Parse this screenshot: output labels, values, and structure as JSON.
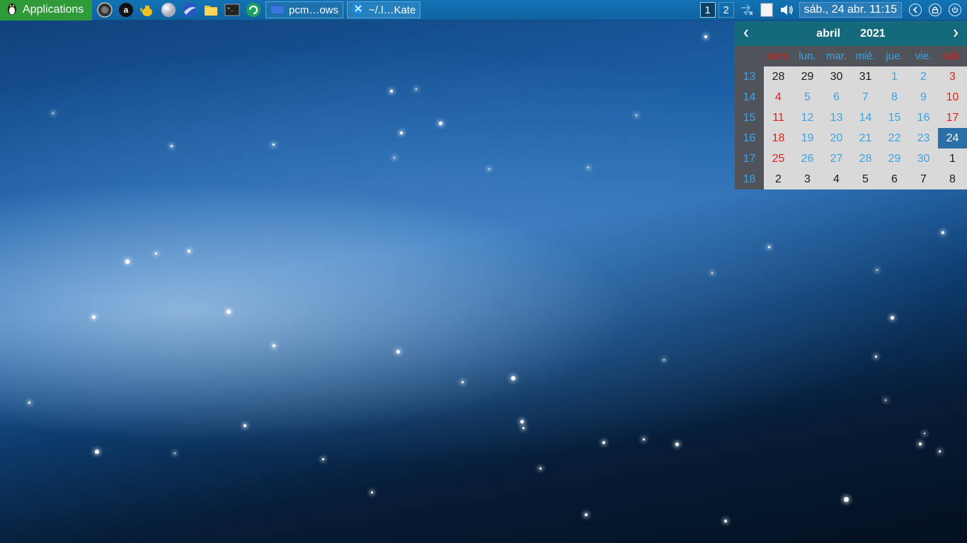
{
  "panel": {
    "app_menu_label": "Applications",
    "tasks": [
      {
        "label": "pcm…ows",
        "icon": "folder-icon"
      },
      {
        "label": "~/.l…Kate",
        "icon": "kate-icon"
      }
    ],
    "workspaces": [
      "1",
      "2"
    ],
    "clock": "sáb., 24 abr. 11:15"
  },
  "calendar": {
    "month": "abril",
    "year": "2021",
    "days_of_week": [
      "dom.",
      "lun.",
      "mar.",
      "mié.",
      "jue.",
      "vie.",
      "sáb."
    ],
    "weeks": [
      {
        "week": "13",
        "days": [
          "28",
          "29",
          "30",
          "31",
          "1",
          "2",
          "3"
        ]
      },
      {
        "week": "14",
        "days": [
          "4",
          "5",
          "6",
          "7",
          "8",
          "9",
          "10"
        ]
      },
      {
        "week": "15",
        "days": [
          "11",
          "12",
          "13",
          "14",
          "15",
          "16",
          "17"
        ]
      },
      {
        "week": "16",
        "days": [
          "18",
          "19",
          "20",
          "21",
          "22",
          "23",
          "24"
        ]
      },
      {
        "week": "17",
        "days": [
          "25",
          "26",
          "27",
          "28",
          "29",
          "30",
          "1"
        ]
      },
      {
        "week": "18",
        "days": [
          "2",
          "3",
          "4",
          "5",
          "6",
          "7",
          "8"
        ]
      }
    ],
    "today": "24"
  },
  "colors": {
    "panel": "#1373b4",
    "app_menu": "#2f9a38",
    "calendar_header": "#14697b",
    "weekday_text": "#3aa4e4",
    "weekend_text": "#e0201a",
    "today_highlight": "#2a6fa8"
  }
}
